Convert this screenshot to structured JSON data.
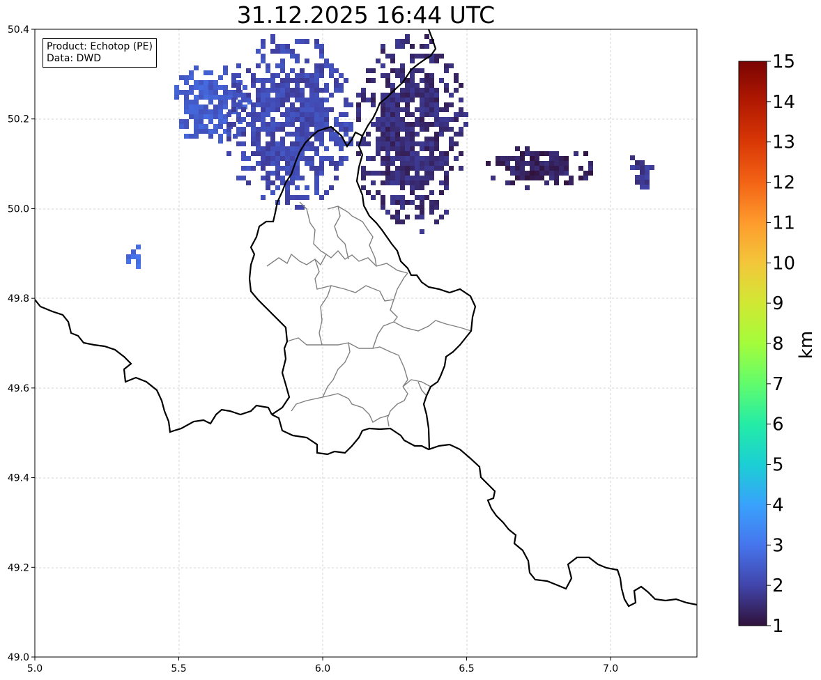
{
  "title": "31.12.2025 16:44 UTC",
  "info": {
    "product": "Product: Echotop (PE)",
    "data": "Data: DWD"
  },
  "map": {
    "lon_range": [
      5.0,
      7.3
    ],
    "lat_range": [
      49.0,
      50.4
    ],
    "x_ticks": [
      "5.0",
      "5.5",
      "6.0",
      "6.5",
      "7.0"
    ],
    "y_ticks": [
      "49.0",
      "49.2",
      "49.4",
      "49.6",
      "49.8",
      "50.0",
      "50.2",
      "50.4"
    ],
    "grid": true
  },
  "colorbar": {
    "label": "km",
    "min": 1,
    "max": 15,
    "ticks": [
      "1",
      "2",
      "3",
      "4",
      "5",
      "6",
      "7",
      "8",
      "9",
      "10",
      "11",
      "12",
      "13",
      "14",
      "15"
    ],
    "colors": [
      "#30123b",
      "#4145ab",
      "#4675ed",
      "#39a2fc",
      "#1bcfd4",
      "#24eca6",
      "#61fc6c",
      "#a4fc3b",
      "#d1e834",
      "#f3c63a",
      "#fe9b2d",
      "#f36315",
      "#d93806",
      "#b11901",
      "#7a0402"
    ]
  },
  "echo_areas": [
    {
      "region": "northwest",
      "lon": [
        5.45,
        5.75
      ],
      "lat": [
        50.15,
        50.33
      ],
      "height_km": 2.5
    },
    {
      "region": "north-central",
      "lon": [
        5.65,
        6.1
      ],
      "lat": [
        50.0,
        50.4
      ],
      "height_km": 2.1
    },
    {
      "region": "north",
      "lon": [
        6.1,
        6.5
      ],
      "lat": [
        49.95,
        50.4
      ],
      "height_km": 1.5
    },
    {
      "region": "northeast",
      "lon": [
        6.55,
        6.95
      ],
      "lat": [
        50.05,
        50.15
      ],
      "height_km": 1.3
    },
    {
      "region": "east",
      "lon": [
        7.05,
        7.15
      ],
      "lat": [
        50.05,
        50.13
      ],
      "height_km": 1.7
    },
    {
      "region": "southwest-isolated",
      "lon": [
        5.3,
        5.37
      ],
      "lat": [
        49.87,
        49.93
      ],
      "height_km": 2.8
    }
  ]
}
